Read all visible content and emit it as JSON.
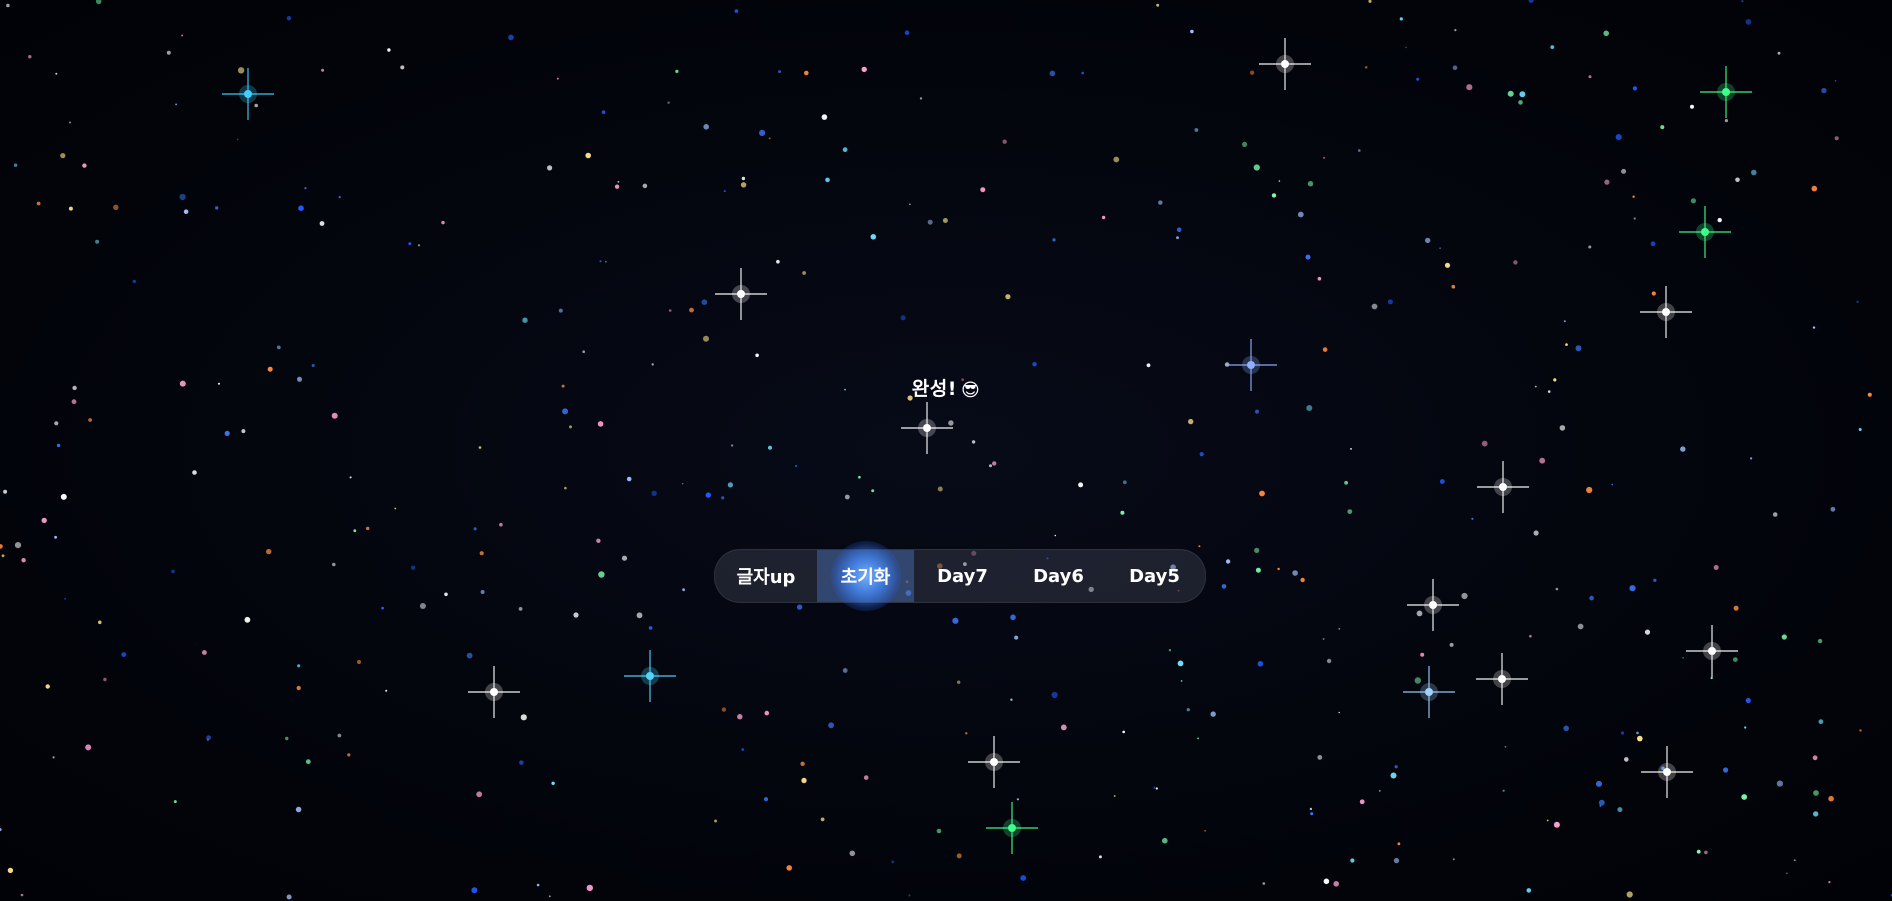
{
  "headline": {
    "text": "완성!",
    "emoji": "😎"
  },
  "nav": {
    "items": [
      {
        "label": "글자up",
        "active": false
      },
      {
        "label": "초기화",
        "active": true
      },
      {
        "label": "Day7",
        "active": false
      },
      {
        "label": "Day6",
        "active": false
      },
      {
        "label": "Day5",
        "active": false
      }
    ]
  },
  "colors": {
    "background": "#03050c",
    "active_glow": "#5a9bff",
    "text": "#ffffff"
  }
}
